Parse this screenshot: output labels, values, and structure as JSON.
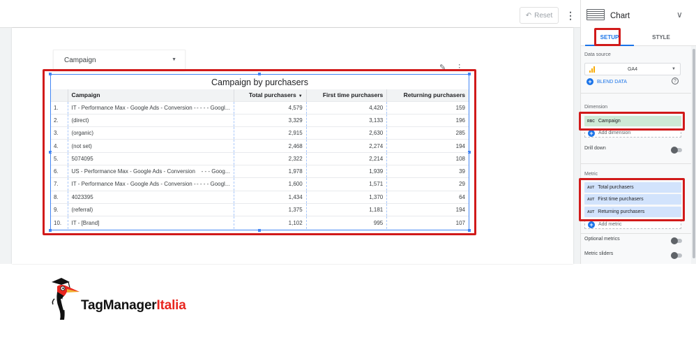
{
  "toolbar": {
    "reset_label": "Reset"
  },
  "control": {
    "label": "Campaign"
  },
  "chart_data": {
    "type": "table",
    "title": "Campaign by purchasers",
    "columns": [
      "Campaign",
      "Total purchasers",
      "First time purchasers",
      "Returning purchasers"
    ],
    "sorted_column": "Total purchasers",
    "rows": [
      {
        "n": "1.",
        "campaign": "IT - Performance Max - Google Ads - Conversion -",
        "suffix": "- - - - Googl...",
        "total": "4,579",
        "first": "4,420",
        "returning": "159"
      },
      {
        "n": "2.",
        "campaign": "(direct)",
        "suffix": "",
        "total": "3,329",
        "first": "3,133",
        "returning": "196"
      },
      {
        "n": "3.",
        "campaign": "(organic)",
        "suffix": "",
        "total": "2,915",
        "first": "2,630",
        "returning": "285"
      },
      {
        "n": "4.",
        "campaign": "(not set)",
        "suffix": "",
        "total": "2,468",
        "first": "2,274",
        "returning": "194"
      },
      {
        "n": "5.",
        "campaign": "5074095",
        "suffix": "",
        "total": "2,322",
        "first": "2,214",
        "returning": "108"
      },
      {
        "n": "6.",
        "campaign": "US - Performance Max - Google Ads - Conversion",
        "suffix": "- - - Goog...",
        "total": "1,978",
        "first": "1,939",
        "returning": "39"
      },
      {
        "n": "7.",
        "campaign": "IT - Performance Max - Google Ads - Conversion -",
        "suffix": "- - - - Googl...",
        "total": "1,600",
        "first": "1,571",
        "returning": "29"
      },
      {
        "n": "8.",
        "campaign": "4023395",
        "suffix": "",
        "total": "1,434",
        "first": "1,370",
        "returning": "64"
      },
      {
        "n": "9.",
        "campaign": "(referral)",
        "suffix": "",
        "total": "1,375",
        "first": "1,181",
        "returning": "194"
      },
      {
        "n": "10.",
        "campaign": "IT - [Brand]",
        "suffix": "",
        "total": "1,102",
        "first": "995",
        "returning": "107"
      }
    ]
  },
  "panel": {
    "title": "Chart",
    "tabs": {
      "setup": "SETUP",
      "style": "STYLE"
    },
    "data_source": {
      "label": "Data source",
      "value": "GA4",
      "blend_label": "BLEND DATA"
    },
    "dimension": {
      "label": "Dimension",
      "chip_type": "RBC",
      "value": "Campaign",
      "add_label": "Add dimension"
    },
    "drill_down": "Drill down",
    "metric": {
      "label": "Metric",
      "chips": [
        {
          "type": "AUT",
          "label": "Total purchasers"
        },
        {
          "type": "AUT",
          "label": "First time purchasers"
        },
        {
          "type": "AUT",
          "label": "Returning purchasers"
        }
      ],
      "add_label": "Add metric"
    },
    "optional_metrics": "Optional metrics",
    "metric_sliders": "Metric sliders"
  },
  "logo": {
    "name_part1": "TagManager",
    "name_part2": "Italia"
  },
  "colors": {
    "highlight_red": "#d11a1a",
    "selection_blue": "#4285f4",
    "dimension_green": "#ceead6",
    "metric_blue": "#d2e3fc",
    "brand_red": "#e8261f"
  }
}
